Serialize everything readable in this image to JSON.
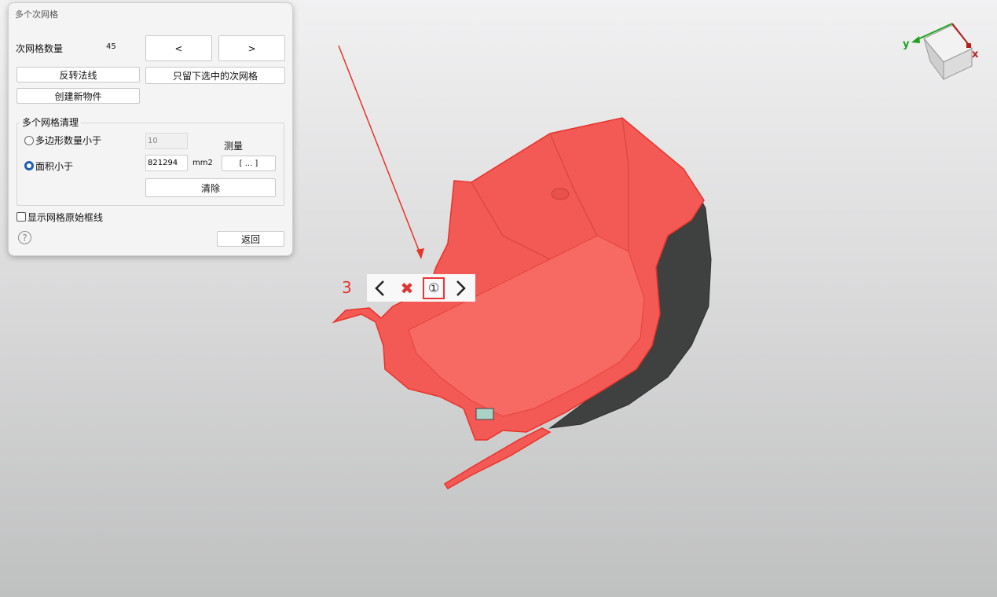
{
  "dialog": {
    "title": "多个次网格",
    "submesh_count_label": "次网格数量",
    "submesh_count_value": "45",
    "prev_label": "<",
    "next_label": ">",
    "flip_normals_label": "反转法线",
    "keep_selected_label": "只留下选中的次网格",
    "create_object_label": "创建新物件",
    "cleanup_group_title": "多个网格清理",
    "polygon_count_label": "多边形数量小于",
    "polygon_count_value": "10",
    "area_label": "面积小于",
    "area_value": "821294",
    "area_unit": "mm2",
    "measure_label": "测量",
    "measure_button_label": "[ ... ]",
    "clear_label": "清除",
    "show_wireframe_label": "显示网格原始框线",
    "help_icon": "?",
    "back_label": "返回",
    "selected_mode": "area"
  },
  "navigator": {
    "count": "3",
    "prev_glyph": "<",
    "delete_glyph": "✖",
    "index_glyph": "①",
    "next_glyph": ">"
  },
  "axis_gizmo": {
    "y_label": "y",
    "x_label": "x"
  },
  "colors": {
    "selected_mesh": "#f35a55",
    "mesh_outline": "#e8332a",
    "unselected_mesh": "#3f4140",
    "arrow": "#e8332a",
    "radio_active": "#1f5fb0"
  }
}
